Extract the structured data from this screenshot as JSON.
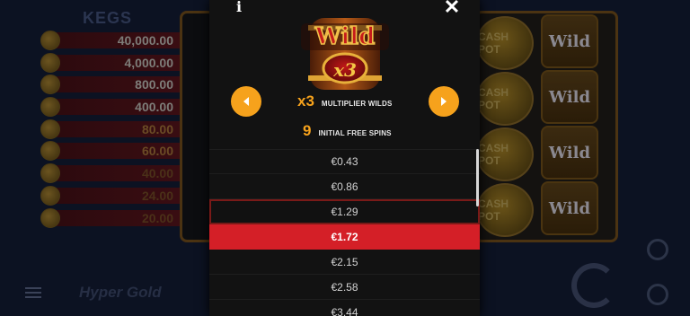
{
  "background": {
    "kegs_title": "KEGS",
    "paytable": [
      "40,000.00",
      "4,000.00",
      "800.00",
      "400.00",
      "80.00",
      "60.00",
      "40.00",
      "24.00",
      "20.00"
    ],
    "symbols": {
      "cash": "CASH POT",
      "wild": "Wild"
    },
    "logo_text": "Hyper Gold"
  },
  "modal": {
    "info_label": "i",
    "close_label": "✕",
    "badge": {
      "title": "Wild",
      "multiplier": "x3"
    },
    "features": [
      {
        "value": "x3",
        "label": "MULTIPLIER WILDS"
      },
      {
        "value": "9",
        "label": "INITIAL FREE SPINS"
      }
    ],
    "bets": [
      "€0.43",
      "€0.86",
      "€1.29",
      "€1.72",
      "€2.15",
      "€2.58",
      "€3.44"
    ],
    "hovered_bet": "€1.29",
    "selected_bet": "€1.72",
    "colors": {
      "accent": "#f6a21c",
      "selected": "#d41f27",
      "panel": "#121212"
    }
  }
}
